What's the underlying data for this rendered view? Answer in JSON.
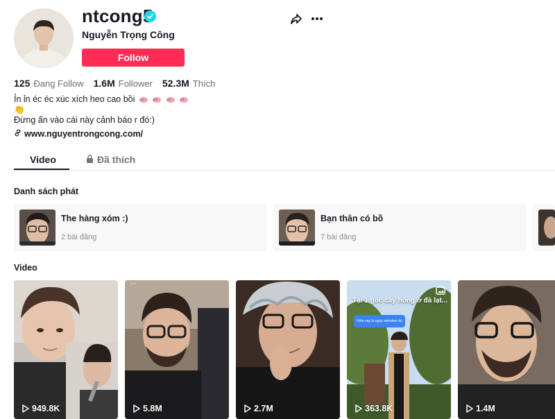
{
  "profile": {
    "username": "ntcong5",
    "nickname": "Nguyễn Trọng Công",
    "verified": true,
    "follow_label": "Follow",
    "accent_color": "#fe2c55",
    "verified_color": "#20d5ec"
  },
  "stats": {
    "following": {
      "value": "125",
      "label": "Đang Follow"
    },
    "followers": {
      "value": "1.6M",
      "label": "Follower"
    },
    "likes": {
      "value": "52.3M",
      "label": "Thích"
    }
  },
  "bio": {
    "line1": "Ỉn ỉn éc éc xúc xích heo cao bồi",
    "line2_emoji": "👏",
    "line3": "Đừng ấn vào cái này cảnh báo r đó:)",
    "link": "www.nguyentrongcong.com/"
  },
  "tabs": {
    "video": "Video",
    "liked": "Đã thích"
  },
  "playlists": {
    "title": "Danh sách phát",
    "items": [
      {
        "title": "The hàng xóm :)",
        "count": "2 bài đăng"
      },
      {
        "title": "Bạn thân có bồ",
        "count": "7 bài đăng"
      }
    ]
  },
  "videos": {
    "title": "Video",
    "items": [
      {
        "views": "949.8K"
      },
      {
        "views": "5.8M"
      },
      {
        "views": "2.7M"
      },
      {
        "views": "363.8K",
        "caption": "Tại 1 góc cây hồng ở đà lạt...",
        "bubble": "Hôm nay là ngày valentine đó"
      },
      {
        "views": "1.4M"
      }
    ]
  },
  "icons": [
    "verified-icon",
    "share-icon",
    "more-icon",
    "lock-icon",
    "link-icon",
    "play-icon",
    "photo-icon",
    "pig-emoji"
  ]
}
